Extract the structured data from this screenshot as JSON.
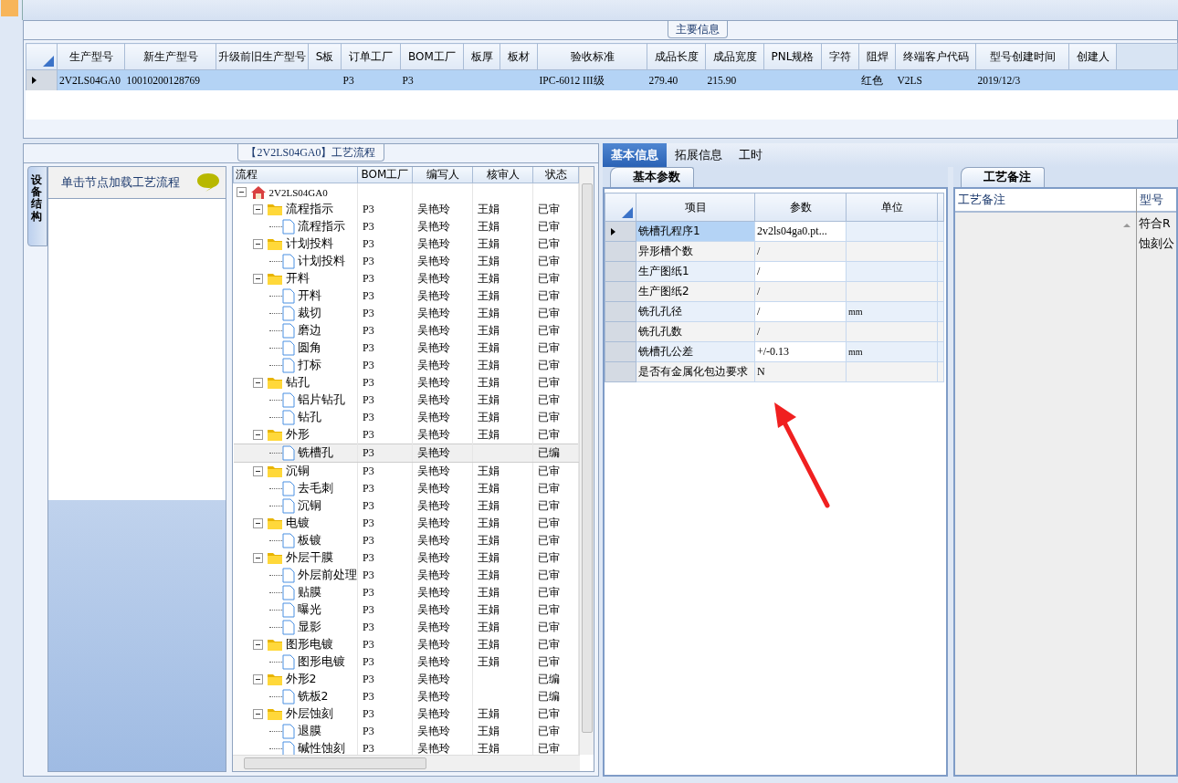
{
  "main_info": {
    "title": "主要信息",
    "columns": [
      "生产型号",
      "新生产型号",
      "升级前旧生产型号",
      "S板",
      "订单工厂",
      "BOM工厂",
      "板厚",
      "板材",
      "验收标准",
      "成品长度",
      "成品宽度",
      "PNL规格",
      "字符",
      "阻焊",
      "终端客户代码",
      "型号创建时间",
      "创建人"
    ],
    "rows": [
      {
        "selected": true,
        "cells": [
          "2V2LS04GA0",
          "10010200128769",
          "",
          "",
          "P3",
          "P3",
          "",
          "",
          "IPC-6012 III级",
          "279.40",
          "215.90",
          "",
          "",
          "红色",
          "V2LS",
          "2019/12/3",
          ""
        ]
      }
    ]
  },
  "side_tab": {
    "label": "设备结构"
  },
  "side_panel": {
    "header": "单击节点加载工艺流程"
  },
  "flow": {
    "title": "【2V2LS04GA0】工艺流程",
    "columns": [
      "流程",
      "BOM工厂",
      "编写人",
      "核审人",
      "状态"
    ],
    "tree": {
      "name": "2V2LS04GA0",
      "expanded": true,
      "children": [
        {
          "name": "流程指示",
          "cells": [
            "P3",
            "吴艳玲",
            "王娟",
            "已审"
          ],
          "expanded": true,
          "children": [
            {
              "name": "流程指示",
              "cells": [
                "P3",
                "吴艳玲",
                "王娟",
                "已审"
              ],
              "selected": false
            }
          ]
        },
        {
          "name": "计划投料",
          "cells": [
            "P3",
            "吴艳玲",
            "王娟",
            "已审"
          ],
          "expanded": true,
          "children": [
            {
              "name": "计划投料",
              "cells": [
                "P3",
                "吴艳玲",
                "王娟",
                "已审"
              ],
              "selected": false
            }
          ]
        },
        {
          "name": "开料",
          "cells": [
            "P3",
            "吴艳玲",
            "王娟",
            "已审"
          ],
          "expanded": true,
          "children": [
            {
              "name": "开料",
              "cells": [
                "P3",
                "吴艳玲",
                "王娟",
                "已审"
              ],
              "selected": false
            },
            {
              "name": "裁切",
              "cells": [
                "P3",
                "吴艳玲",
                "王娟",
                "已审"
              ],
              "selected": false
            },
            {
              "name": "磨边",
              "cells": [
                "P3",
                "吴艳玲",
                "王娟",
                "已审"
              ],
              "selected": false
            },
            {
              "name": "圆角",
              "cells": [
                "P3",
                "吴艳玲",
                "王娟",
                "已审"
              ],
              "selected": false
            },
            {
              "name": "打标",
              "cells": [
                "P3",
                "吴艳玲",
                "王娟",
                "已审"
              ],
              "selected": false
            }
          ]
        },
        {
          "name": "钻孔",
          "cells": [
            "P3",
            "吴艳玲",
            "王娟",
            "已审"
          ],
          "expanded": true,
          "children": [
            {
              "name": "铝片钻孔",
              "cells": [
                "P3",
                "吴艳玲",
                "王娟",
                "已审"
              ],
              "selected": false
            },
            {
              "name": "钻孔",
              "cells": [
                "P3",
                "吴艳玲",
                "王娟",
                "已审"
              ],
              "selected": false
            }
          ]
        },
        {
          "name": "外形",
          "cells": [
            "P3",
            "吴艳玲",
            "王娟",
            "已审"
          ],
          "expanded": true,
          "children": [
            {
              "name": "铣槽孔",
              "cells": [
                "P3",
                "吴艳玲",
                "",
                "已编"
              ],
              "selected": true
            }
          ]
        },
        {
          "name": "沉铜",
          "cells": [
            "P3",
            "吴艳玲",
            "王娟",
            "已审"
          ],
          "expanded": true,
          "children": [
            {
              "name": "去毛刺",
              "cells": [
                "P3",
                "吴艳玲",
                "王娟",
                "已审"
              ],
              "selected": false
            },
            {
              "name": "沉铜",
              "cells": [
                "P3",
                "吴艳玲",
                "王娟",
                "已审"
              ],
              "selected": false
            }
          ]
        },
        {
          "name": "电镀",
          "cells": [
            "P3",
            "吴艳玲",
            "王娟",
            "已审"
          ],
          "expanded": true,
          "children": [
            {
              "name": "板镀",
              "cells": [
                "P3",
                "吴艳玲",
                "王娟",
                "已审"
              ],
              "selected": false
            }
          ]
        },
        {
          "name": "外层干膜",
          "cells": [
            "P3",
            "吴艳玲",
            "王娟",
            "已审"
          ],
          "expanded": true,
          "children": [
            {
              "name": "外层前处理",
              "cells": [
                "P3",
                "吴艳玲",
                "王娟",
                "已审"
              ],
              "selected": false
            },
            {
              "name": "贴膜",
              "cells": [
                "P3",
                "吴艳玲",
                "王娟",
                "已审"
              ],
              "selected": false
            },
            {
              "name": "曝光",
              "cells": [
                "P3",
                "吴艳玲",
                "王娟",
                "已审"
              ],
              "selected": false
            },
            {
              "name": "显影",
              "cells": [
                "P3",
                "吴艳玲",
                "王娟",
                "已审"
              ],
              "selected": false
            }
          ]
        },
        {
          "name": "图形电镀",
          "cells": [
            "P3",
            "吴艳玲",
            "王娟",
            "已审"
          ],
          "expanded": true,
          "children": [
            {
              "name": "图形电镀",
              "cells": [
                "P3",
                "吴艳玲",
                "王娟",
                "已审"
              ],
              "selected": false
            }
          ]
        },
        {
          "name": "外形2",
          "cells": [
            "P3",
            "吴艳玲",
            "",
            "已编"
          ],
          "expanded": true,
          "children": [
            {
              "name": "铣板2",
              "cells": [
                "P3",
                "吴艳玲",
                "",
                "已编"
              ],
              "selected": false
            }
          ]
        },
        {
          "name": "外层蚀刻",
          "cells": [
            "P3",
            "吴艳玲",
            "王娟",
            "已审"
          ],
          "expanded": true,
          "children": [
            {
              "name": "退膜",
              "cells": [
                "P3",
                "吴艳玲",
                "王娟",
                "已审"
              ],
              "selected": false
            },
            {
              "name": "碱性蚀刻",
              "cells": [
                "P3",
                "吴艳玲",
                "王娟",
                "已审"
              ],
              "selected": false
            }
          ]
        }
      ]
    }
  },
  "detail_tabs": [
    {
      "label": "基本信息",
      "selected": true
    },
    {
      "label": "拓展信息",
      "selected": false
    },
    {
      "label": "工时",
      "selected": false
    }
  ],
  "params": {
    "tab": "基本参数",
    "columns": [
      "项目",
      "参数",
      "单位"
    ],
    "rows": [
      {
        "item": "铣槽孔程序1",
        "value": "2v2ls04ga0.pt...",
        "unit": "",
        "selected": true
      },
      {
        "item": "异形槽个数",
        "value": "/",
        "unit": "",
        "selected": false
      },
      {
        "item": "生产图纸1",
        "value": "/",
        "unit": "",
        "selected": false
      },
      {
        "item": "生产图纸2",
        "value": "/",
        "unit": "",
        "selected": false
      },
      {
        "item": "铣孔孔径",
        "value": "/",
        "unit": "mm",
        "selected": false
      },
      {
        "item": "铣孔孔数",
        "value": "/",
        "unit": "",
        "selected": false
      },
      {
        "item": "铣槽孔公差",
        "value": "+/-0.13",
        "unit": "mm",
        "selected": false
      },
      {
        "item": "是否有金属化包边要求",
        "value": "N",
        "unit": "",
        "selected": false
      }
    ]
  },
  "notes": {
    "tab": "工艺备注",
    "columns": [
      "工艺备注",
      "型号"
    ],
    "column_2_lines": [
      "符合R",
      "蚀刻公"
    ]
  }
}
